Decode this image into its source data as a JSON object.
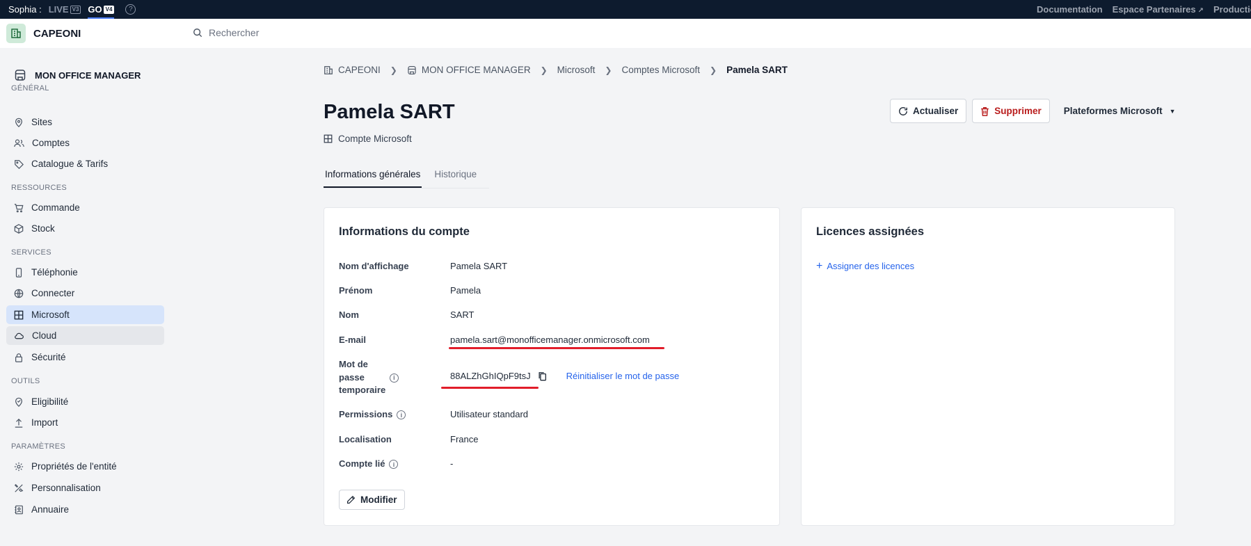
{
  "topbar": {
    "user": "Sophia :",
    "envs": [
      {
        "label": "LIVE",
        "badge": "V3"
      },
      {
        "label": "GO",
        "badge": "V4"
      }
    ],
    "help": "?",
    "links": [
      "Documentation",
      "Espace Partenaires",
      "Production"
    ]
  },
  "header": {
    "org_name": "CAPEONI",
    "search_placeholder": "Rechercher"
  },
  "sidebar": {
    "entity": "MON OFFICE MANAGER",
    "sections": {
      "general": "GÉNÉRAL",
      "resources": "RESSOURCES",
      "services": "SERVICES",
      "tools": "OUTILS",
      "settings": "PARAMÈTRES"
    },
    "items": {
      "sites": "Sites",
      "comptes": "Comptes",
      "catalogue": "Catalogue & Tarifs",
      "commande": "Commande",
      "stock": "Stock",
      "telephonie": "Téléphonie",
      "connecter": "Connecter",
      "microsoft": "Microsoft",
      "cloud": "Cloud",
      "securite": "Sécurité",
      "eligibilite": "Eligibilité",
      "import": "Import",
      "proprietes": "Propriétés de l'entité",
      "personnalisation": "Personnalisation",
      "annuaire": "Annuaire"
    }
  },
  "breadcrumb": [
    "CAPEONI",
    "MON OFFICE MANAGER",
    "Microsoft",
    "Comptes Microsoft",
    "Pamela SART"
  ],
  "page": {
    "title": "Pamela SART",
    "subtitle": "Compte Microsoft",
    "actions": {
      "refresh": "Actualiser",
      "delete": "Supprimer",
      "platforms": "Plateformes Microsoft"
    },
    "tabs": [
      "Informations générales",
      "Historique"
    ]
  },
  "account_card": {
    "title": "Informations du compte",
    "fields": {
      "display_name": {
        "label": "Nom d'affichage",
        "value": "Pamela SART"
      },
      "first_name": {
        "label": "Prénom",
        "value": "Pamela"
      },
      "last_name": {
        "label": "Nom",
        "value": "SART"
      },
      "email": {
        "label": "E-mail",
        "value": "pamela.sart@monofficemanager.onmicrosoft.com"
      },
      "temp_password": {
        "label_lines": [
          "Mot de",
          "passe",
          "temporaire"
        ],
        "value": "88ALZhGhIQpF9tsJ",
        "reset_link": "Réinitialiser le mot de passe"
      },
      "permissions": {
        "label": "Permissions",
        "value": "Utilisateur standard"
      },
      "location": {
        "label": "Localisation",
        "value": "France"
      },
      "linked_account": {
        "label": "Compte lié",
        "value": "-"
      }
    },
    "edit_button": "Modifier"
  },
  "licenses_card": {
    "title": "Licences assignées",
    "assign_link": "Assigner des licences"
  },
  "colors": {
    "topbar": "#0d1b2e",
    "accent": "#2563eb",
    "danger": "#b91c1c",
    "annotation": "#e11d2a",
    "active_nav": "#d6e4fb"
  }
}
